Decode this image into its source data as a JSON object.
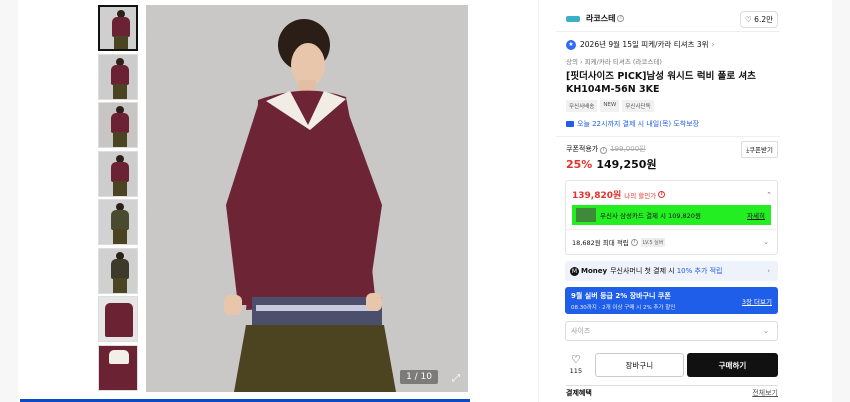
{
  "gallery": {
    "counter": "1 / 10",
    "thumb_count": 8
  },
  "brand": {
    "name": "라코스테",
    "likes": "6.2만"
  },
  "rank": {
    "text": "2026년 9월 15일 피케/카라 티셔츠 3위"
  },
  "breadcrumb": "상의  ›  피케/카라 티셔츠 (라코스테)",
  "product": {
    "title": "[핏더사이즈 PICK]남성 워시드 럭비 폴로 셔츠 KH104M-56N 3KE",
    "tags": [
      "무신사배송",
      "NEW",
      "무신사단독"
    ],
    "delivery": "오늘 22시까지 결제 시 내일(목) 도착보장"
  },
  "price": {
    "label": "쿠폰적용가",
    "original": "199,000원",
    "discount": "25%",
    "current": "149,250원",
    "coupon_button": "쿠폰받기"
  },
  "benefit": {
    "my_price": "139,820원",
    "my_price_label": "나의 할인가",
    "card_text": "무신사 삼성카드 결제 시 109,820원",
    "card_detail": "자세히",
    "points": "18,682원 최대 적립",
    "level": "LV.5 실버"
  },
  "money": {
    "prefix": "Money",
    "text": "무신사머니 첫 결제 시",
    "highlight": "10% 추가 적립"
  },
  "banner": {
    "line1": "9월 실버 등급 2% 장바구니 쿠폰",
    "line2": "08.30까지 · 2개 이상 구매 시 2% 추가 할인",
    "more": "3장 더보기"
  },
  "size_select": "사이즈",
  "actions": {
    "like_count": "115",
    "cart": "장바구니",
    "buy": "구매하기"
  },
  "payment": {
    "title": "결제혜택",
    "all": "전체보기"
  },
  "colors": {
    "accent_blue": "#1e5ee8",
    "discount_red": "#e3332c",
    "green_highlight": "#22ee22"
  }
}
